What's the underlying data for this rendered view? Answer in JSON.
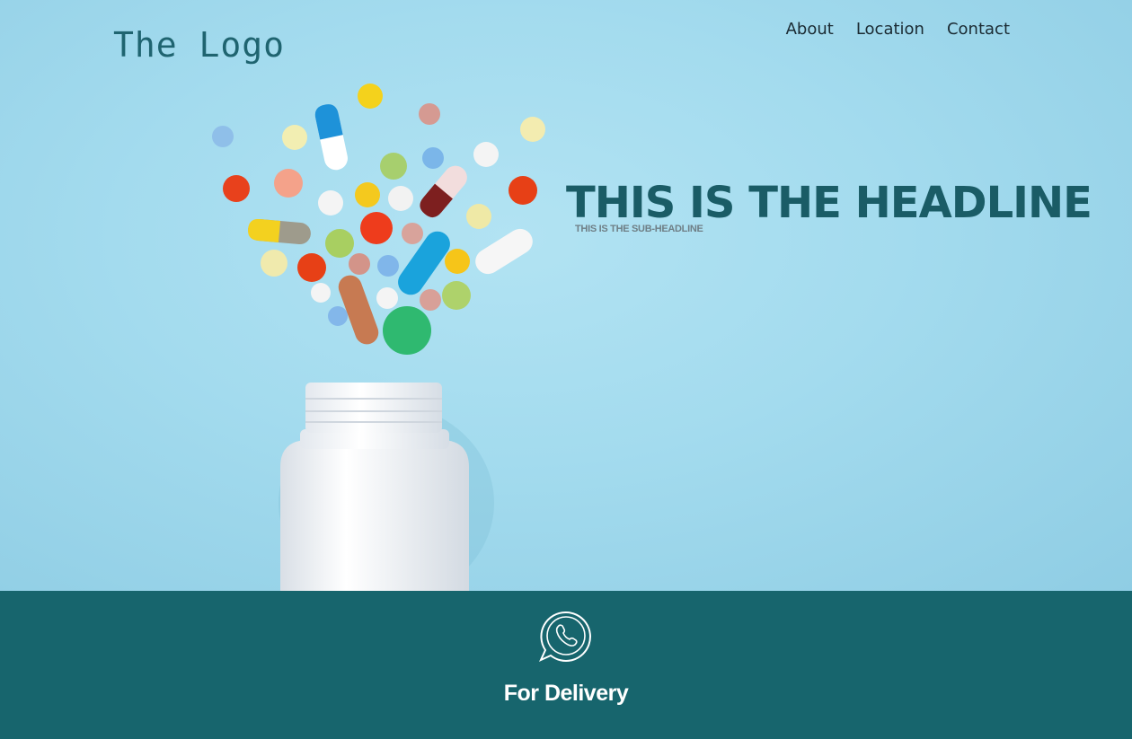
{
  "header": {
    "logo": "The Logo",
    "nav": [
      {
        "label": "About"
      },
      {
        "label": "Location"
      },
      {
        "label": "Contact"
      }
    ]
  },
  "hero": {
    "headline": "THIS IS THE HEADLINE",
    "subheadline": "THIS IS THE SUB-HEADLINE"
  },
  "footer": {
    "icon": "whatsapp-icon",
    "label": "For Delivery"
  },
  "colors": {
    "hero_bg": "#a3dbee",
    "brand_teal": "#17656d",
    "headline": "#1a5c66"
  }
}
